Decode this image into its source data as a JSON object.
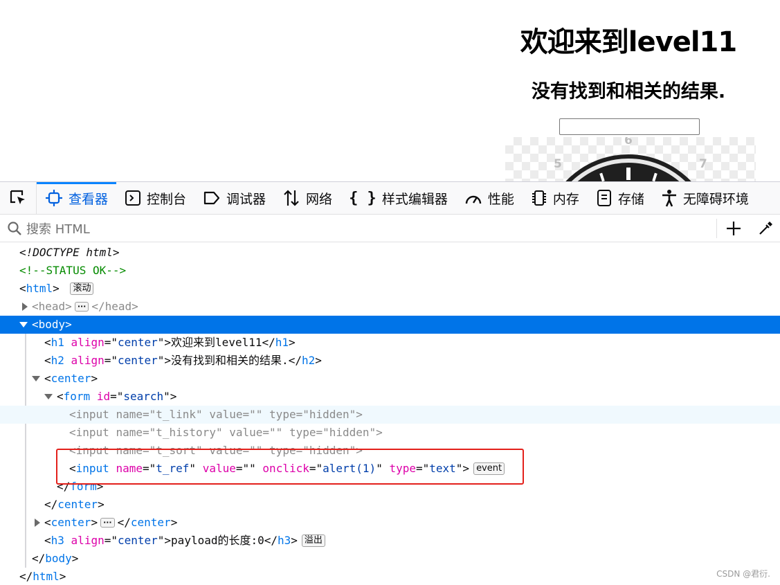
{
  "preview": {
    "h1": "欢迎来到level11",
    "h2": "没有找到和相关的结果.",
    "clock_numbers": [
      "5",
      "6",
      "7"
    ]
  },
  "toolbar": {
    "tabs": [
      {
        "label": "查看器",
        "icon": "inspector-icon",
        "active": true
      },
      {
        "label": "控制台",
        "icon": "console-icon"
      },
      {
        "label": "调试器",
        "icon": "debugger-icon"
      },
      {
        "label": "网络",
        "icon": "network-icon"
      },
      {
        "label": "样式编辑器",
        "icon": "style-editor-icon"
      },
      {
        "label": "性能",
        "icon": "performance-icon"
      },
      {
        "label": "内存",
        "icon": "memory-icon"
      },
      {
        "label": "存储",
        "icon": "storage-icon"
      },
      {
        "label": "无障碍环境",
        "icon": "accessibility-icon"
      }
    ]
  },
  "search": {
    "placeholder": "搜索 HTML"
  },
  "tree": {
    "doctype": "<!DOCTYPE html>",
    "comment": "<!--STATUS OK-->",
    "html_tag": "html",
    "scroll_badge": "滚动",
    "head_tag": "head",
    "body_tag": "body",
    "h1": {
      "tag": "h1",
      "attr": "align",
      "value": "center",
      "text": "欢迎来到level11"
    },
    "h2": {
      "tag": "h2",
      "attr": "align",
      "value": "center",
      "text": "没有找到和相关的结果."
    },
    "center_tag": "center",
    "form": {
      "tag": "form",
      "attr": "id",
      "value": "search"
    },
    "inputs": [
      {
        "tag": "input",
        "name": "t_link",
        "value": "",
        "type": "hidden"
      },
      {
        "tag": "input",
        "name": "t_history",
        "value": "",
        "type": "hidden"
      },
      {
        "tag": "input",
        "name": "t_sort",
        "value": "",
        "type": "hidden"
      }
    ],
    "ref_input": {
      "tag": "input",
      "name": "t_ref",
      "value": "",
      "onclick": "alert(1)",
      "type": "text",
      "badge": "event"
    },
    "h3": {
      "tag": "h3",
      "attr": "align",
      "value": "center",
      "text": "payload的长度:0"
    },
    "overflow_badge": "溢出"
  },
  "watermark": "CSDN @君衍."
}
